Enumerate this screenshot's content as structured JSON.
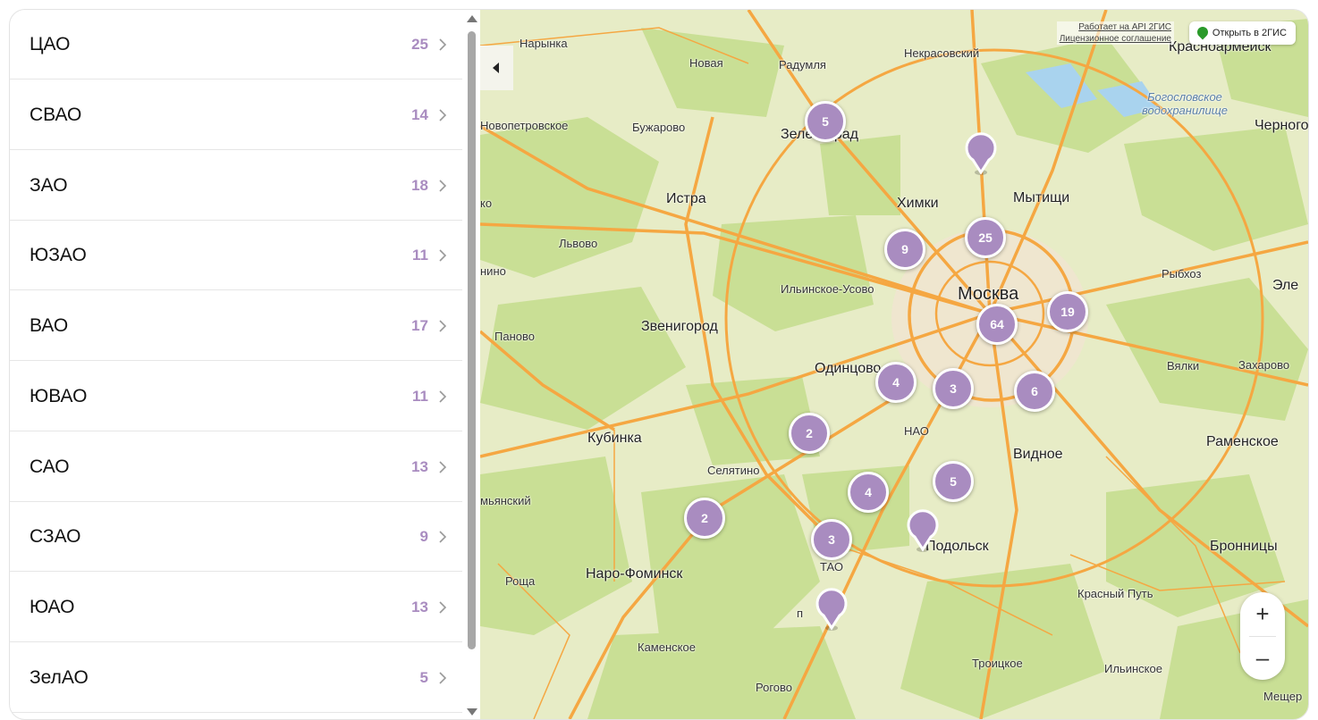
{
  "districts": [
    {
      "name": "ЦАО",
      "count": "25"
    },
    {
      "name": "СВАО",
      "count": "14"
    },
    {
      "name": "ЗАО",
      "count": "18"
    },
    {
      "name": "ЮЗАО",
      "count": "11"
    },
    {
      "name": "ВАО",
      "count": "17"
    },
    {
      "name": "ЮВАО",
      "count": "11"
    },
    {
      "name": "САО",
      "count": "13"
    },
    {
      "name": "СЗАО",
      "count": "9"
    },
    {
      "name": "ЮАО",
      "count": "13"
    },
    {
      "name": "ЗелАО",
      "count": "5"
    }
  ],
  "map": {
    "attribution": {
      "api": "Работает на API 2ГИС",
      "license": "Лицензионное соглашение"
    },
    "open_button": "Открыть в 2ГИС",
    "zoom_in": "+",
    "zoom_out": "–",
    "clusters": [
      "5",
      "25",
      "9",
      "64",
      "19",
      "4",
      "3",
      "6",
      "2",
      "4",
      "5",
      "2",
      "3"
    ],
    "labels": {
      "narynka": "Нарынка",
      "novaya": "Новая",
      "radumlya": "Радумля",
      "nekrasovsky": "Некрасовский",
      "krasnoarmeysk": "Красноармейск",
      "bogoslovskoe": "Богословское водохранилище",
      "chernogolovka": "Черного",
      "novopetrovskoe": "Новопетровское",
      "buzharovo": "Бужарово",
      "zelenograd": "Зеленоград",
      "istra": "Истра",
      "khimki": "Химки",
      "mytishchi": "Мытищи",
      "lvovo": "Львово",
      "nino": "нино",
      "ilinskoe": "Ильинское-Усово",
      "moskva": "Москва",
      "rybkhoz": "Рыбхоз",
      "ele": "Эле",
      "panovo": "Паново",
      "zvenigorod": "Звенигород",
      "odintsovo": "Одинцово",
      "vlyaki": "Вялки",
      "zakharovo": "Захарово",
      "kubinka": "Кубинка",
      "nao": "НАО",
      "ramenskoe": "Раменское",
      "selyatino": "Селятино",
      "vidnoe": "Видное",
      "myanskiy": "мьянский",
      "podolsk": "Подольск",
      "bronnitsy": "Бронницы",
      "naro": "Наро-Фоминск",
      "tao": "ТАО",
      "roshcha": "Роща",
      "krasny_put": "Красный Путь",
      "kamenskoe": "Каменское",
      "troitskoe": "Троицкое",
      "ilinskoe2": "Ильинское",
      "rogovo": "Рогово",
      "meshcher": "Мещер",
      "k": "ко",
      "p": "п"
    }
  }
}
